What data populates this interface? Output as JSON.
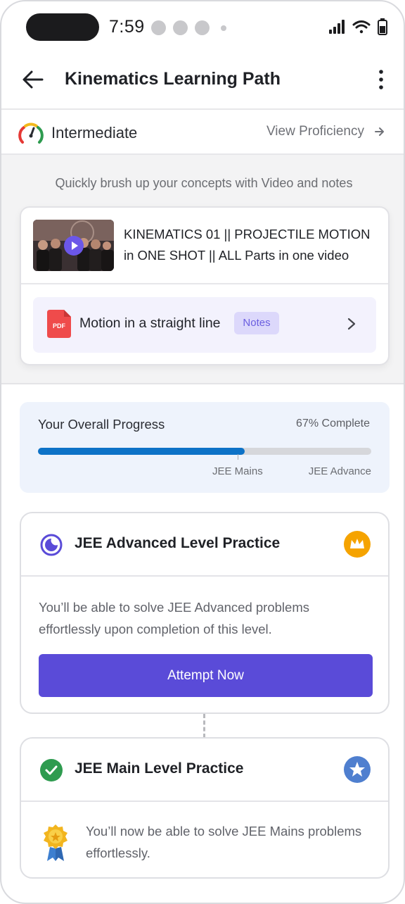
{
  "status_bar": {
    "time": "7:59"
  },
  "header": {
    "title": "Kinematics Learning Path"
  },
  "level": {
    "label": "Intermediate",
    "link": "View Proficiency"
  },
  "resources": {
    "subtitle": "Quickly brush up your concepts with Video and notes",
    "video_title": "KINEMATICS 01 || PROJECTILE MOTION in ONE SHOT || ALL Parts in one video",
    "notes_title": "Motion in a straight line",
    "notes_badge": "Notes",
    "pdf_label": "PDF"
  },
  "progress": {
    "title": "Your Overall Progress",
    "percent_label": "67% Complete",
    "fill_fraction": 0.62,
    "markers": {
      "mains": "JEE Mains",
      "advance": "JEE Advance"
    }
  },
  "advanced_card": {
    "title": "JEE Advanced Level Practice",
    "description": "You’ll be able to solve JEE Advanced problems effortlessly upon completion of this level.",
    "button": "Attempt Now"
  },
  "main_card": {
    "title": "JEE Main Level Practice",
    "description": "You’ll now be able to solve JEE Mains problems effortlessly."
  },
  "colors": {
    "accent": "#5a4bd8",
    "progress_fill": "#0d72c7",
    "crown_badge": "#f5a300",
    "star_badge": "#4f7fcf",
    "check": "#2e9b4f"
  },
  "icons": [
    "back-arrow-icon",
    "kebab-menu-icon",
    "gauge-icon",
    "arrow-right-icon",
    "play-icon",
    "pdf-icon",
    "chevron-right-icon",
    "moon-icon",
    "crown-icon",
    "check-circle-icon",
    "star-icon",
    "medal-icon",
    "signal-icon",
    "wifi-icon",
    "battery-icon"
  ]
}
